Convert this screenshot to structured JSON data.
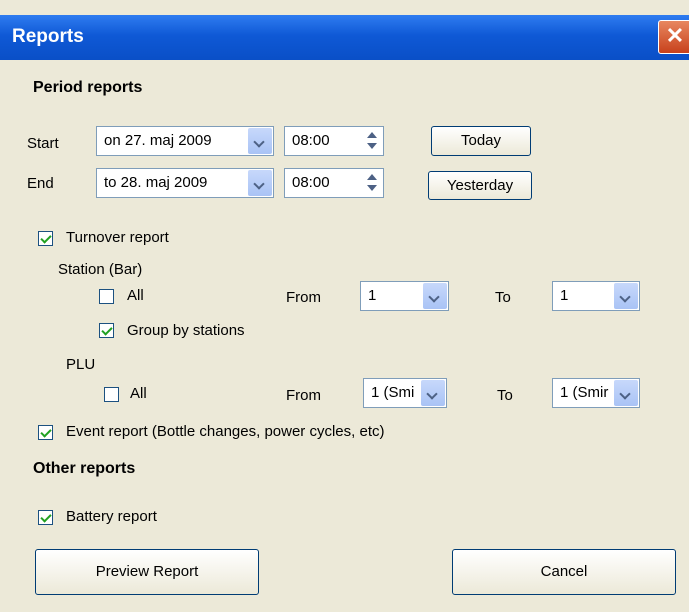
{
  "window": {
    "title": "Reports",
    "close_glyph": "✕"
  },
  "period": {
    "heading": "Period reports",
    "start_label": "Start",
    "start_date": "on 27. maj 2009",
    "start_time": "08:00",
    "end_label": "End",
    "end_date": "to 28. maj 2009",
    "end_time": "08:00",
    "today_button": "Today",
    "yesterday_button": "Yesterday"
  },
  "turnover": {
    "label": "Turnover report",
    "checked": true,
    "station": {
      "heading": "Station (Bar)",
      "all_label": "All",
      "all_checked": false,
      "from_label": "From",
      "from_value": "1",
      "to_label": "To",
      "to_value": "1",
      "group_label": "Group by stations",
      "group_checked": true
    },
    "plu": {
      "heading": "PLU",
      "all_label": "All",
      "all_checked": false,
      "from_label": "From",
      "from_value": "1 (Smi",
      "to_label": "To",
      "to_value": "1 (Smir"
    }
  },
  "event": {
    "label": "Event report (Bottle changes, power cycles, etc)",
    "checked": true
  },
  "other": {
    "heading": "Other reports",
    "battery_label": "Battery report",
    "battery_checked": true
  },
  "footer": {
    "preview_button": "Preview Report",
    "cancel_button": "Cancel"
  }
}
